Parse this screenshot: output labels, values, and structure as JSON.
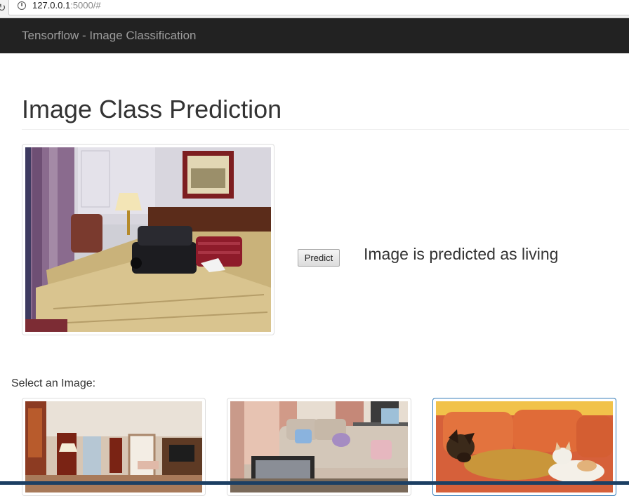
{
  "browser": {
    "reload_glyph": "C",
    "url_host": "127.0.0.1",
    "url_rest": ":5000/#"
  },
  "navbar": {
    "brand": "Tensorflow - Image Classification"
  },
  "main": {
    "title": "Image Class Prediction",
    "predict_label": "Predict",
    "result_text": "Image is predicted as living"
  },
  "gallery": {
    "label": "Select an Image:"
  }
}
